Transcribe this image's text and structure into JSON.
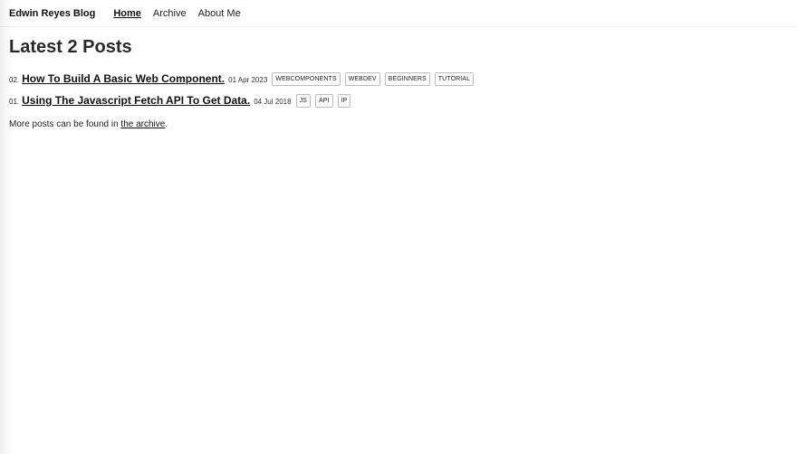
{
  "header": {
    "site_title": "Edwin Reyes Blog",
    "nav": [
      {
        "label": "Home",
        "active": true
      },
      {
        "label": "Archive",
        "active": false
      },
      {
        "label": "About Me",
        "active": false
      }
    ]
  },
  "main": {
    "title": "Latest 2 Posts",
    "posts": [
      {
        "number": "02.",
        "title": "How To Build A Basic Web Component.",
        "date": "01 Apr 2023",
        "tags": [
          "WEBCOMPONENTS",
          "WEBDEV",
          "BEGINNERS",
          "TUTORIAL"
        ]
      },
      {
        "number": "01.",
        "title": "Using The Javascript Fetch API To Get Data.",
        "date": "04 Jul 2018",
        "tags": [
          "JS",
          "API",
          "IP"
        ]
      }
    ],
    "more": {
      "prefix": "More posts can be found in ",
      "link_text": "the archive",
      "suffix": "."
    }
  }
}
